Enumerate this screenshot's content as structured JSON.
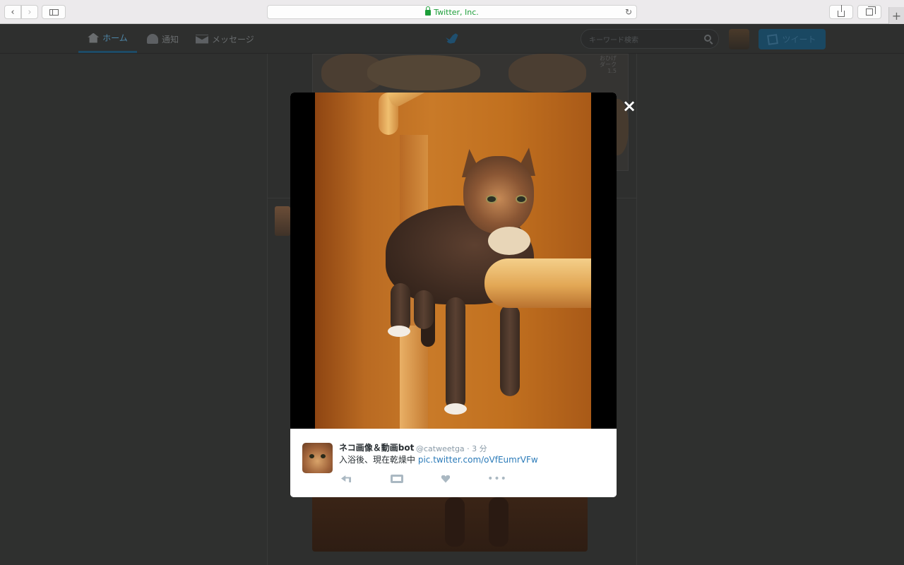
{
  "browser": {
    "address": "Twitter, Inc.",
    "icons": {
      "back": "chevron-left-icon",
      "forward": "chevron-right-icon",
      "sidebar": "sidebar-icon",
      "lock": "lock-icon",
      "reload": "reload-icon",
      "share": "share-icon",
      "tabs": "tabs-icon",
      "new_tab": "plus-icon"
    }
  },
  "nav": {
    "home": "ホーム",
    "notifications": "通知",
    "messages": "メッセージ",
    "search_placeholder": "キーワード検索",
    "tweet_button": "ツイート"
  },
  "background": {
    "photo_text": "おひげ ダーク 1.5"
  },
  "modal": {
    "close": "×",
    "tweet": {
      "name": "ネコ画像＆動画bot",
      "handle": "@catweetga",
      "separator": "·",
      "time": "3 分",
      "text": "入浴後、現在乾燥中",
      "link": "pic.twitter.com/oVfEumrVFw",
      "more": "•••"
    }
  },
  "colors": {
    "link": "#2b7bb9",
    "secure": "#1c9e39",
    "accent": "#1a4862"
  }
}
